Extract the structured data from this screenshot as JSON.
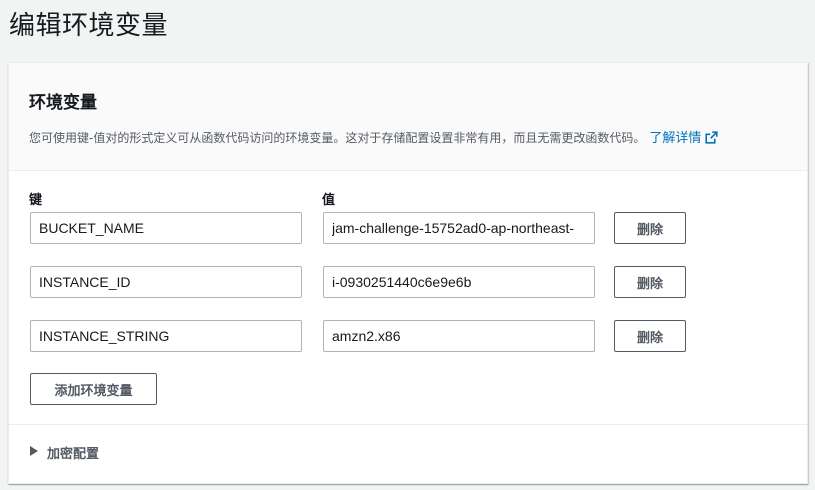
{
  "page": {
    "title": "编辑环境变量"
  },
  "panel": {
    "title": "环境变量",
    "description": "您可使用键-值对的形式定义可从函数代码访问的环境变量。这对于存储配置设置非常有用，而且无需更改函数代码。",
    "learn_more": "了解详情",
    "key_label": "键",
    "value_label": "值",
    "remove_label": "删除",
    "add_label": "添加环境变量",
    "encryption_label": "加密配置",
    "accent_color": "#0073bb",
    "rows": [
      {
        "key": "BUCKET_NAME",
        "value": "jam-challenge-15752ad0-ap-northeast-"
      },
      {
        "key": "INSTANCE_ID",
        "value": "i-0930251440c6e9e6b"
      },
      {
        "key": "INSTANCE_STRING",
        "value": "amzn2.x86"
      }
    ]
  },
  "icons": {
    "external_link": "external-link-icon",
    "expand": "caret-right-icon"
  }
}
